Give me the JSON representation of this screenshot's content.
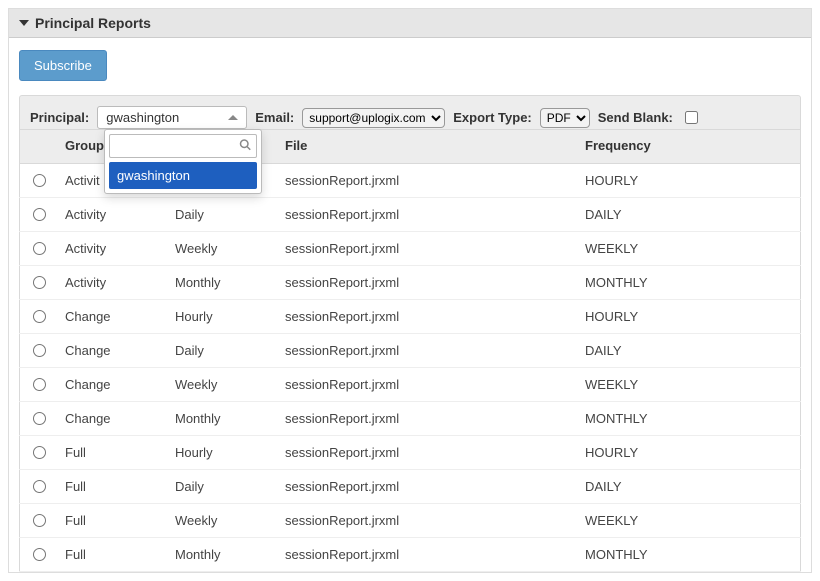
{
  "panel": {
    "title": "Principal Reports"
  },
  "actions": {
    "subscribe": "Subscribe"
  },
  "filters": {
    "principal_label": "Principal:",
    "principal_value": "gwashington",
    "principal_dropdown": {
      "search_value": "",
      "options": [
        "gwashington"
      ]
    },
    "email_label": "Email:",
    "email_value": "support@uplogix.com",
    "export_type_label": "Export Type:",
    "export_type_value": "PDF",
    "send_blank_label": "Send Blank:",
    "send_blank_checked": false
  },
  "table": {
    "headers": {
      "group": "Group",
      "file": "File",
      "frequency": "Frequency"
    },
    "rows": [
      {
        "group": "Activit",
        "period": "",
        "file": "sessionReport.jrxml",
        "freq": "HOURLY"
      },
      {
        "group": "Activity",
        "period": "Daily",
        "file": "sessionReport.jrxml",
        "freq": "DAILY"
      },
      {
        "group": "Activity",
        "period": "Weekly",
        "file": "sessionReport.jrxml",
        "freq": "WEEKLY"
      },
      {
        "group": "Activity",
        "period": "Monthly",
        "file": "sessionReport.jrxml",
        "freq": "MONTHLY"
      },
      {
        "group": "Change",
        "period": "Hourly",
        "file": "sessionReport.jrxml",
        "freq": "HOURLY"
      },
      {
        "group": "Change",
        "period": "Daily",
        "file": "sessionReport.jrxml",
        "freq": "DAILY"
      },
      {
        "group": "Change",
        "period": "Weekly",
        "file": "sessionReport.jrxml",
        "freq": "WEEKLY"
      },
      {
        "group": "Change",
        "period": "Monthly",
        "file": "sessionReport.jrxml",
        "freq": "MONTHLY"
      },
      {
        "group": "Full",
        "period": "Hourly",
        "file": "sessionReport.jrxml",
        "freq": "HOURLY"
      },
      {
        "group": "Full",
        "period": "Daily",
        "file": "sessionReport.jrxml",
        "freq": "DAILY"
      },
      {
        "group": "Full",
        "period": "Weekly",
        "file": "sessionReport.jrxml",
        "freq": "WEEKLY"
      },
      {
        "group": "Full",
        "period": "Monthly",
        "file": "sessionReport.jrxml",
        "freq": "MONTHLY"
      }
    ]
  }
}
